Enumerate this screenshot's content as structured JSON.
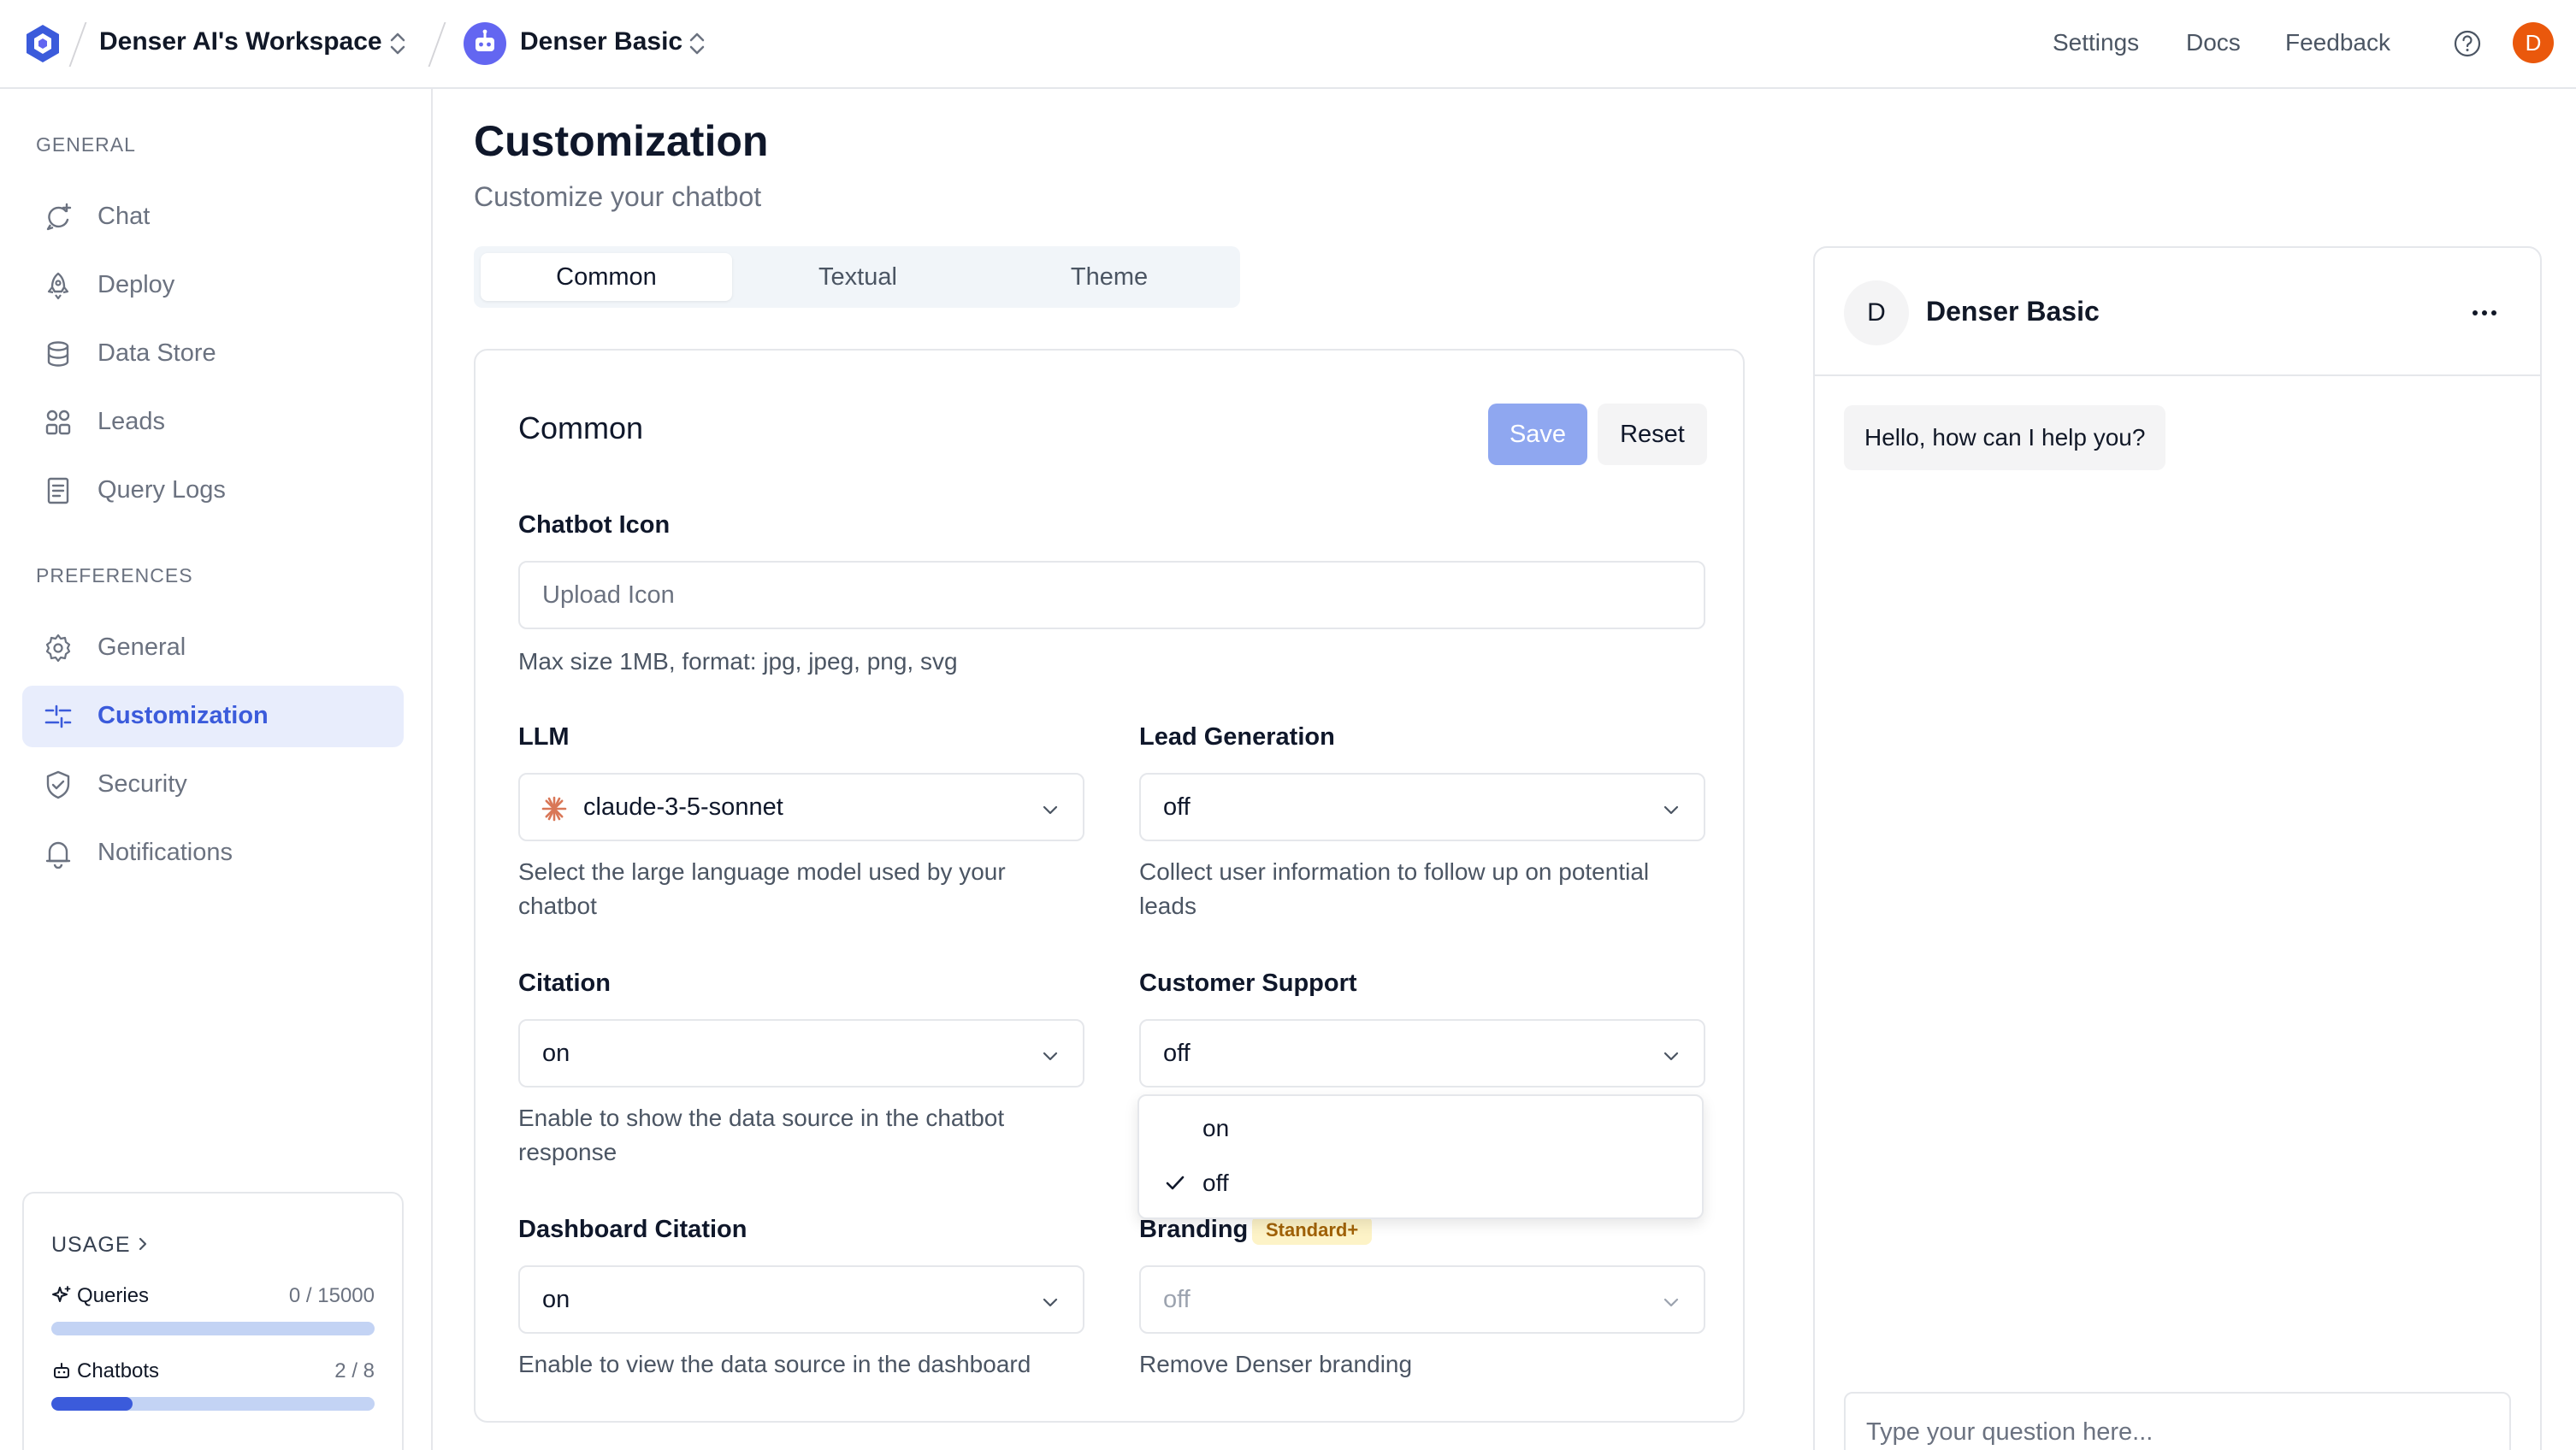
{
  "header": {
    "workspace": "Denser AI's Workspace",
    "chatbot": "Denser Basic",
    "links": [
      "Settings",
      "Docs",
      "Feedback"
    ],
    "user_initial": "D"
  },
  "sidebar": {
    "general_label": "GENERAL",
    "general_items": [
      "Chat",
      "Deploy",
      "Data Store",
      "Leads",
      "Query Logs"
    ],
    "preferences_label": "PREFERENCES",
    "preference_items": [
      "General",
      "Customization",
      "Security",
      "Notifications"
    ],
    "active_item": "Customization",
    "usage": {
      "title": "USAGE",
      "queries": {
        "label": "Queries",
        "value": "0 / 15000",
        "fraction": 0.0
      },
      "chatbots": {
        "label": "Chatbots",
        "value": "2 / 8",
        "fraction": 0.25
      }
    }
  },
  "main": {
    "title": "Customization",
    "subtitle": "Customize your chatbot",
    "tabs": [
      "Common",
      "Textual",
      "Theme"
    ],
    "active_tab": "Common",
    "card": {
      "title": "Common",
      "save_label": "Save",
      "reset_label": "Reset",
      "chatbot_icon": {
        "label": "Chatbot Icon",
        "placeholder": "Upload Icon",
        "help": "Max size 1MB, format: jpg, jpeg, png, svg"
      },
      "llm": {
        "label": "LLM",
        "value": "claude-3-5-sonnet",
        "help": "Select the large language model used by your chatbot"
      },
      "lead_generation": {
        "label": "Lead Generation",
        "value": "off",
        "help": "Collect user information to follow up on potential leads"
      },
      "citation": {
        "label": "Citation",
        "value": "on",
        "help": "Enable to show the data source in the chatbot response"
      },
      "customer_support": {
        "label": "Customer Support",
        "value": "off",
        "options": [
          "on",
          "off"
        ],
        "selected": "off"
      },
      "dashboard_citation": {
        "label": "Dashboard Citation",
        "value": "on",
        "help": "Enable to view the data source in the dashboard"
      },
      "branding": {
        "label": "Branding",
        "badge": "Standard+",
        "value": "off",
        "help": "Remove Denser branding"
      }
    }
  },
  "preview": {
    "avatar_initial": "D",
    "name": "Denser Basic",
    "greeting": "Hello, how can I help you?",
    "input_placeholder": "Type your question here..."
  },
  "colors": {
    "accent": "#3b5bdb",
    "accent_soft": "#e8edfc",
    "save_disabled": "#8fa7f0",
    "badge_bg": "#fdf3c7",
    "user_avatar": "#ea580c"
  }
}
